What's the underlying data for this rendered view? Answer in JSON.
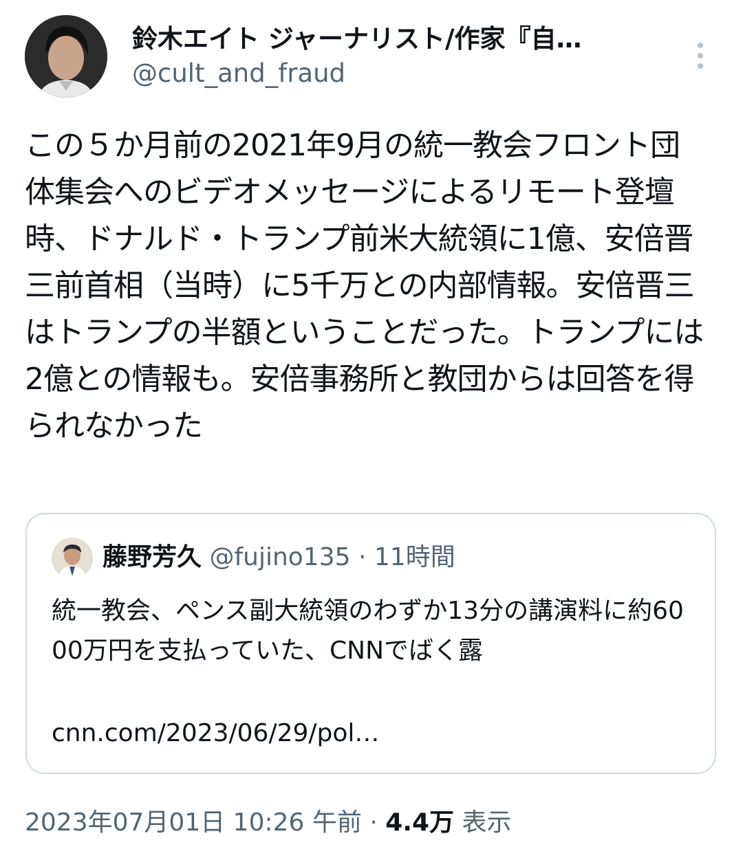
{
  "author": {
    "name": "鈴木エイト ジャーナリスト/作家『自…",
    "handle": "@cult_and_fraud",
    "avatar_icon": "profile-photo"
  },
  "menu_icon": "more-vertical-icon",
  "tweet_text": "この５か月前の2021年9月の統一教会フロント団体集会へのビデオメッセージによるリモート登壇時、ドナルド・トランプ前米大統領に1億、安倍晋三前首相（当時）に5千万との内部情報。安倍晋三はトランプの半額ということだった。トランプには2億との情報も。安倍事務所と教団からは回答を得られなかった",
  "quote": {
    "name": "藤野芳久",
    "handle": "@fujino135",
    "separator": "·",
    "time": "11時間",
    "text": "統一教会、ペンス副大統領のわずか13分の講演料に約6000万円を支払っていた、CNNでばく露",
    "link": "cnn.com/2023/06/29/pol…"
  },
  "footer": {
    "timestamp": "2023年07月01日 10:26 午前",
    "separator": "·",
    "views_count": "4.4万",
    "views_label": "表示"
  },
  "colors": {
    "text_primary": "#0f1419",
    "text_secondary": "#536471",
    "border": "#cfd9de"
  }
}
